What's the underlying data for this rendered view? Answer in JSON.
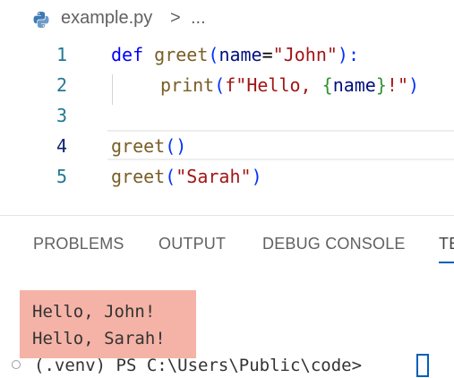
{
  "breadcrumb": {
    "file_name": "example.py",
    "separator": ">",
    "more": "..."
  },
  "editor": {
    "lines": [
      {
        "number": "1",
        "tokens": [
          "def",
          " ",
          "greet",
          "(",
          "name",
          "=",
          "\"John\"",
          "):"
        ]
      },
      {
        "number": "2",
        "tokens": [
          "print",
          "(",
          "f\"Hello, ",
          "{",
          "name",
          "}",
          "!\"",
          ")"
        ]
      },
      {
        "number": "3",
        "tokens": []
      },
      {
        "number": "4",
        "tokens": [
          "greet",
          "()"
        ]
      },
      {
        "number": "5",
        "tokens": [
          "greet",
          "(",
          "\"Sarah\"",
          ")"
        ]
      }
    ],
    "active_line": "4"
  },
  "panel": {
    "tabs": [
      "PROBLEMS",
      "OUTPUT",
      "DEBUG CONSOLE",
      "TE"
    ],
    "active_tab": "TE"
  },
  "terminal": {
    "output": [
      "Hello, John!",
      "Hello, Sarah!"
    ],
    "prompt": "(.venv) PS C:\\Users\\Public\\code>"
  },
  "colors": {
    "keyword": "#0000ff",
    "function": "#795e26",
    "string": "#a31515",
    "variable": "#001080",
    "line_number": "#237893",
    "highlight": "#f4b3a6",
    "accent": "#005fb8"
  },
  "icons": {
    "file_type": "python-file-icon",
    "prompt_status": "circle-status-icon"
  }
}
